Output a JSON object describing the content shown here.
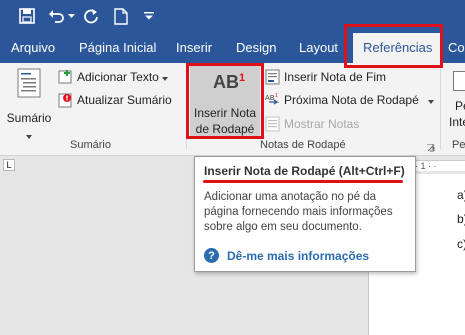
{
  "quick_access": {
    "items": [
      "save-icon",
      "undo-icon",
      "redo-icon",
      "new-document-icon",
      "customize-quick-access-icon"
    ]
  },
  "tabs": [
    {
      "label": "Arquivo"
    },
    {
      "label": "Página Inicial"
    },
    {
      "label": "Inserir"
    },
    {
      "label": "Design"
    },
    {
      "label": "Layout"
    },
    {
      "label": "Referências"
    },
    {
      "label": "Co"
    }
  ],
  "ribbon": {
    "sumario": {
      "big_button_label": "Sumário",
      "add_text_label": "Adicionar Texto",
      "update_label": "Atualizar Sumário",
      "group_label": "Sumário"
    },
    "notas": {
      "big_button_icon_text": "AB",
      "big_button_icon_sup": "1",
      "big_button_label_line1": "Inserir Nota",
      "big_button_label_line2": "de Rodapé",
      "insert_endnote_label": "Inserir Nota de Fim",
      "next_footnote_label": "Próxima Nota de Rodapé",
      "show_notes_label": "Mostrar Notas",
      "group_label": "Notas de Rodapé"
    },
    "cut_off": {
      "line1": "Pe",
      "line2": "Inte",
      "group_label": "Pe"
    }
  },
  "tooltip": {
    "title": "Inserir Nota de Rodapé (Alt+Ctrl+F)",
    "description": "Adicionar uma anotação no pé da página fornecendo mais informações sobre algo em seu documento.",
    "help_link": "Dê-me mais informações"
  },
  "document": {
    "ruler_marker": "L",
    "ruler_text": "· 1 · ·",
    "list_items": [
      "a)",
      "b)",
      "c)"
    ]
  },
  "colors": {
    "brand": "#2b579a",
    "highlight": "#e0101a",
    "help_blue": "#2b6cb0"
  }
}
